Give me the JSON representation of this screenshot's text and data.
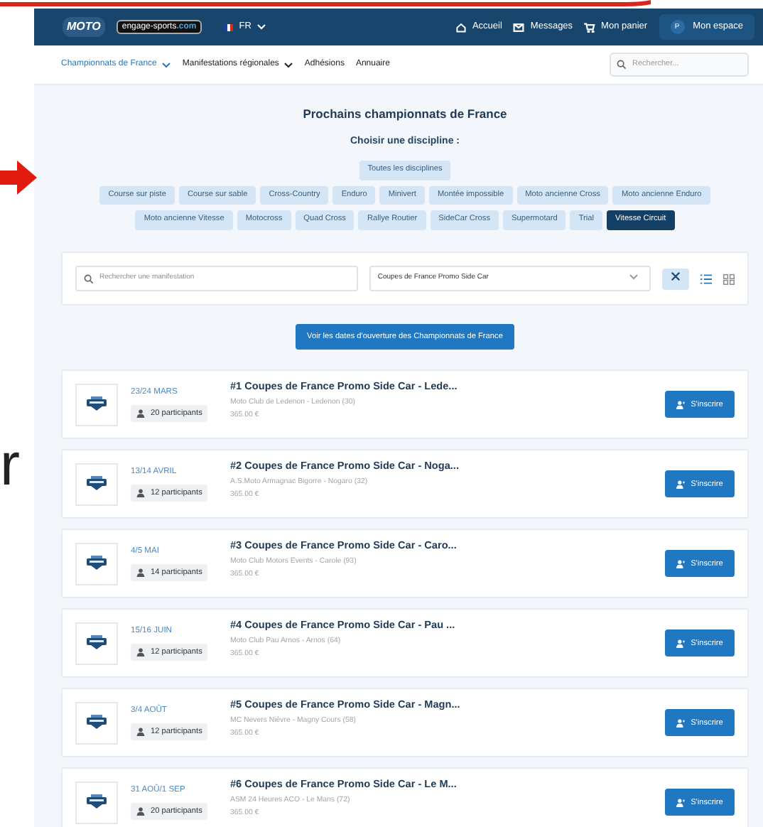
{
  "backdrop": {
    "letter": "r"
  },
  "header": {
    "logo": "MOTO",
    "partner_logo": "engage-sports",
    "partner_suffix": ".com",
    "language": "FR",
    "links": [
      {
        "kind": "home",
        "label": "Accueil"
      },
      {
        "kind": "mail",
        "label": "Messages"
      },
      {
        "kind": "cart",
        "label": "Mon panier"
      }
    ],
    "account": {
      "initials": "P",
      "label": "Mon espace"
    }
  },
  "nav": {
    "items": [
      {
        "label": "Championnats de France",
        "dropdown": true,
        "selected": true
      },
      {
        "label": "Manifestations régionales",
        "dropdown": true,
        "selected": false
      },
      {
        "label": "Adhésions",
        "dropdown": false,
        "selected": false
      },
      {
        "label": "Annuaire",
        "dropdown": false,
        "selected": false
      }
    ],
    "search": {
      "placeholder": "Rechercher..."
    }
  },
  "title": "Prochains championnats de France",
  "subtitle": "Choisir une discipline :",
  "all_disciplines": {
    "label": "Toutes les disciplines",
    "selected": false
  },
  "disciplines": [
    {
      "label": "Course sur piste",
      "selected": false
    },
    {
      "label": "Course sur sable",
      "selected": false
    },
    {
      "label": "Cross-Country",
      "selected": false
    },
    {
      "label": "Enduro",
      "selected": false
    },
    {
      "label": "Minivert",
      "selected": false
    },
    {
      "label": "Montée impossible",
      "selected": false
    },
    {
      "label": "Moto ancienne Cross",
      "selected": false
    },
    {
      "label": "Moto ancienne Enduro",
      "selected": false
    },
    {
      "label": "Moto ancienne Vitesse",
      "selected": false
    },
    {
      "label": "Motocross",
      "selected": false
    },
    {
      "label": "Quad Cross",
      "selected": false
    },
    {
      "label": "Rallye Routier",
      "selected": false
    },
    {
      "label": "SideCar Cross",
      "selected": false
    },
    {
      "label": "Supermotard",
      "selected": false
    },
    {
      "label": "Trial",
      "selected": false
    },
    {
      "label": "Vitesse Circuit",
      "selected": true
    }
  ],
  "filter": {
    "search": {
      "placeholder": "Rechercher une manifestation"
    },
    "select": {
      "value": "Coupes de France Promo Side Car"
    },
    "views": [
      {
        "kind": "list",
        "selected": true
      },
      {
        "kind": "grid",
        "selected": false
      }
    ]
  },
  "cta": "Voir les dates d'ouverture des Championnats de France",
  "events": [
    {
      "date": "23/24 MARS",
      "participants": "20 participants",
      "title": "#1 Coupes de France Promo Side Car - Lede...",
      "place": "Moto Club de Ledenon - Ledenon (30)",
      "price": "365.00 €",
      "button": "S'inscrire"
    },
    {
      "date": "13/14 AVRIL",
      "participants": "12 participants",
      "title": "#2 Coupes de France Promo Side Car - Noga...",
      "place": "A.S.Moto Armagnac Bigorre - Nogaro (32)",
      "price": "365.00 €",
      "button": "S'inscrire"
    },
    {
      "date": "4/5 MAI",
      "participants": "14 participants",
      "title": "#3 Coupes de France Promo Side Car - Caro...",
      "place": "Moto Club Motors Events - Carole (93)",
      "price": "365.00 €",
      "button": "S'inscrire"
    },
    {
      "date": "15/16 JUIN",
      "participants": "12 participants",
      "title": "#4 Coupes de France Promo Side Car - Pau ...",
      "place": "Moto Club Pau Arnos - Arnos (64)",
      "price": "365.00 €",
      "button": "S'inscrire"
    },
    {
      "date": "3/4 AOÛT",
      "participants": "12 participants",
      "title": "#5 Coupes de France Promo Side Car - Magn...",
      "place": "MC Nevers Nièvre - Magny Cours (58)",
      "price": "365.00 €",
      "button": "S'inscrire"
    },
    {
      "date": "31 AOÛ/1 SEP",
      "participants": "20 participants",
      "title": "#6 Coupes de France Promo Side Car - Le M...",
      "place": "ASM 24 Heures ACO - Le Mans (72)",
      "price": "365.00 €",
      "button": "S'inscrire"
    }
  ]
}
